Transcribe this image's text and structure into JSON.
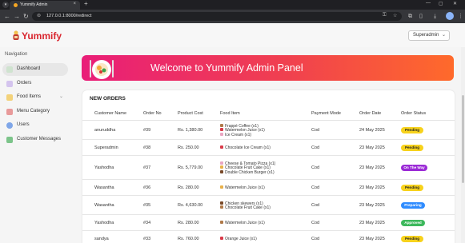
{
  "browser": {
    "tab_title": "Yummify Admin",
    "url": "127.0.0.1:8000/redirect"
  },
  "header": {
    "logo_text": "Yummify",
    "user_menu_label": "Superadmin"
  },
  "sidebar": {
    "title": "Navigation",
    "items": [
      {
        "label": "Dashboard",
        "icon": "dashboard-icon",
        "active": true
      },
      {
        "label": "Orders",
        "icon": "orders-icon"
      },
      {
        "label": "Food Items",
        "icon": "food-items-icon"
      },
      {
        "label": "Menu Category",
        "icon": "menu-category-icon"
      },
      {
        "label": "Users",
        "icon": "users-icon"
      },
      {
        "label": "Customer Messages",
        "icon": "messages-icon"
      }
    ]
  },
  "banner": {
    "title": "Welcome to Yummify Admin Panel"
  },
  "orders": {
    "title": "NEW ORDERS",
    "columns": [
      "Customer Name",
      "Order No",
      "Product Cost",
      "Food Item",
      "Payment Mode",
      "Order Date",
      "Order Status"
    ],
    "rows": [
      {
        "customer": "anuruddha",
        "order_no": "#39",
        "cost": "Rs. 1,380.00",
        "items": [
          "Frappé Coffee (x1)",
          "Watermelon Juice (x1)",
          "Ice Cream (x1)"
        ],
        "payment": "Cod",
        "date": "24 May 2025",
        "status": "Pending"
      },
      {
        "customer": "Superadmin",
        "order_no": "#38",
        "cost": "Rs. 250.00",
        "items": [
          "Chocolate Ice Cream (x1)"
        ],
        "payment": "Cod",
        "date": "23 May 2025",
        "status": "Pending"
      },
      {
        "customer": "Yashodha",
        "order_no": "#37",
        "cost": "Rs. 5,779.00",
        "items": [
          "Cheese & Tomato Pizza (x1)",
          "Chocolate Fruit Cake (x1)",
          "Double Chicken Burger (x1)"
        ],
        "payment": "Cod",
        "date": "23 May 2025",
        "status": "On The Way"
      },
      {
        "customer": "Wasantha",
        "order_no": "#36",
        "cost": "Rs. 280.00",
        "items": [
          "Watermelon Juice (x1)"
        ],
        "payment": "Cod",
        "date": "23 May 2025",
        "status": "Pending"
      },
      {
        "customer": "Wasantha",
        "order_no": "#35",
        "cost": "Rs. 4,630.00",
        "items": [
          "Chicken skewers (x1)",
          "Chocolate Fruit Cake (x1)"
        ],
        "payment": "Cod",
        "date": "23 May 2025",
        "status": "Preparing"
      },
      {
        "customer": "Yashodha",
        "order_no": "#34",
        "cost": "Rs. 280.00",
        "items": [
          "Watermelon Juice (x1)"
        ],
        "payment": "Cod",
        "date": "23 May 2025",
        "status": "Approved"
      },
      {
        "customer": "sandya",
        "order_no": "#33",
        "cost": "Rs. 760.00",
        "items": [
          "Orange Juice (x1)"
        ],
        "payment": "Cod",
        "date": "23 May 2025",
        "status": "Pending"
      }
    ]
  },
  "colors": {
    "brand": "#d9262f",
    "status_pending": "#f7d21c",
    "status_on_the_way": "#9b2bd6",
    "status_preparing": "#2f8cff",
    "status_approved": "#3db85c"
  }
}
